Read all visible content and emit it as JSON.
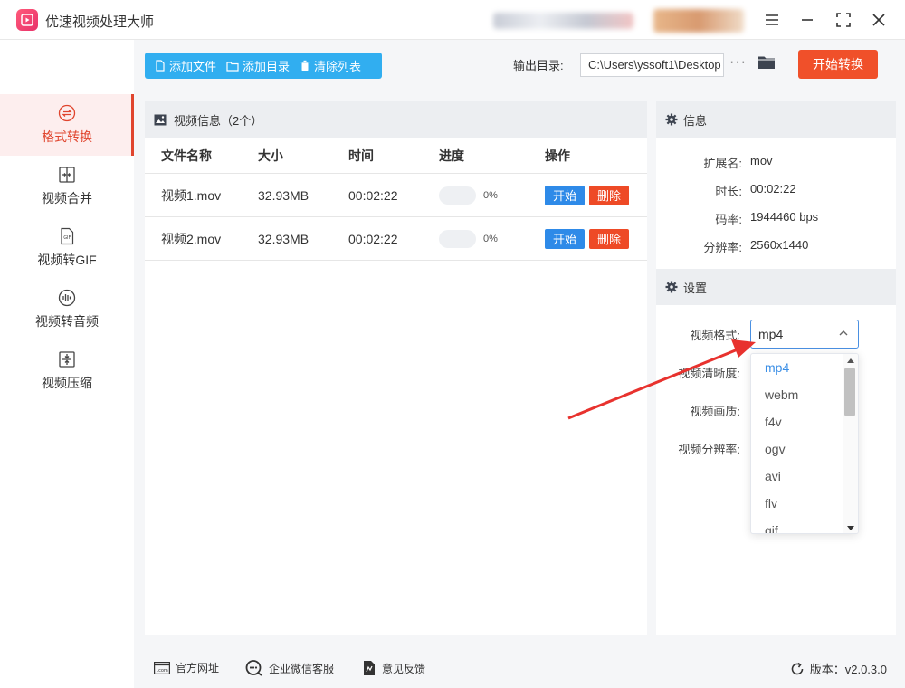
{
  "app": {
    "title": "优速视频处理大师"
  },
  "sidebar": {
    "items": [
      {
        "label": "格式转换",
        "active": true,
        "icon": "convert-icon"
      },
      {
        "label": "视频合并",
        "icon": "merge-icon"
      },
      {
        "label": "视频转GIF",
        "icon": "gif-icon"
      },
      {
        "label": "视频转音频",
        "icon": "audio-icon"
      },
      {
        "label": "视频压缩",
        "icon": "compress-icon"
      }
    ]
  },
  "toolbar": {
    "add_file": "添加文件",
    "add_dir": "添加目录",
    "clear_list": "清除列表",
    "output_label": "输出目录:",
    "output_path": "C:\\Users\\yssoft1\\Desktop",
    "more": "···",
    "start_all": "开始转换"
  },
  "video_list": {
    "header": "视频信息（2个）",
    "columns": [
      "文件名称",
      "大小",
      "时间",
      "进度",
      "操作"
    ],
    "rows": [
      {
        "name": "视频1.mov",
        "size": "32.93MB",
        "duration": "00:02:22",
        "progress": "0%",
        "start": "开始",
        "delete": "删除"
      },
      {
        "name": "视频2.mov",
        "size": "32.93MB",
        "duration": "00:02:22",
        "progress": "0%",
        "start": "开始",
        "delete": "删除"
      }
    ]
  },
  "info": {
    "header": "信息",
    "ext_label": "扩展名:",
    "ext": "mov",
    "dur_label": "时长:",
    "dur": "00:02:22",
    "bitrate_label": "码率:",
    "bitrate": "1944460 bps",
    "res_label": "分辨率:",
    "res": "2560x1440"
  },
  "settings": {
    "header": "设置",
    "format_label": "视频格式:",
    "format_value": "mp4",
    "clarity_label": "视频清晰度:",
    "quality_label": "视频画质:",
    "resolution_label": "视频分辨率:",
    "options": [
      "mp4",
      "webm",
      "f4v",
      "ogv",
      "avi",
      "flv",
      "gif"
    ]
  },
  "footer": {
    "website": "官方网址",
    "wechat": "企业微信客服",
    "feedback": "意见反馈",
    "version": "版本：v2.0.3.0"
  },
  "colors": {
    "accent": "#f0502a",
    "blue": "#31aef0",
    "primary": "#2e8ae8",
    "danger": "#ee4a26"
  }
}
